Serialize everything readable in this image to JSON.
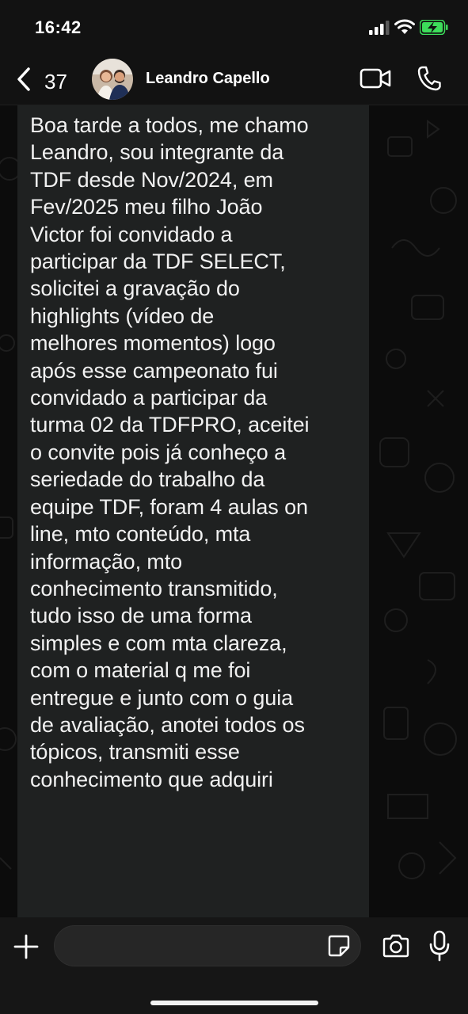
{
  "status_bar": {
    "time": "16:42"
  },
  "header": {
    "back_count": "37",
    "contact_name": "Leandro Capello"
  },
  "message": {
    "text": "Boa tarde a todos, me chamo\nLeandro, sou integrante da\nTDF desde Nov/2024, em\nFev/2025 meu filho João\nVictor foi convidado a\nparticipar da TDF SELECT,\nsolicitei a gravação do\nhighlights (vídeo de\nmelhores momentos) logo\napós esse campeonato fui\nconvidado a participar da\nturma 02 da TDFPRO, aceitei\no convite pois já conheço a\nseriedade do trabalho da\nequipe TDF, foram 4 aulas on\nline, mto conteúdo, mta\ninformação, mto\nconhecimento transmitido,\ntudo isso de uma forma\nsimples e com mta clareza,\ncom o material q me foi\nentregue e junto com o guia\nde avaliação, anotei todos os\ntópicos, transmiti esse\nconhecimento que adquiri"
  },
  "composer": {
    "value": "",
    "placeholder": ""
  },
  "icons": {
    "back": "chevron-left-icon",
    "video": "video-camera-icon",
    "phone": "phone-icon",
    "plus": "plus-icon",
    "sticker": "sticker-icon",
    "camera": "camera-icon",
    "mic": "microphone-icon",
    "scroll": "chevron-down-icon"
  },
  "colors": {
    "battery": "#3ddc5a",
    "bubble": "#1f2121",
    "background": "#0c0c0c"
  }
}
